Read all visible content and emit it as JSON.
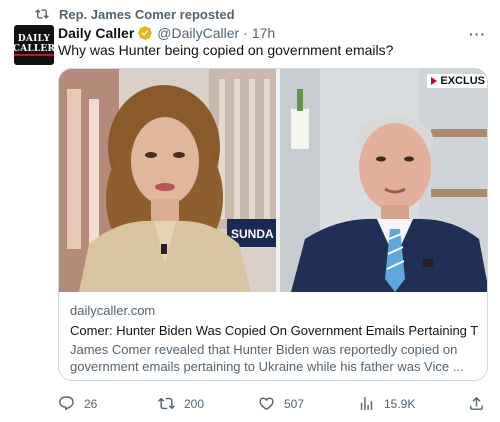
{
  "repost": {
    "text": "Rep. James Comer reposted",
    "icon": "repost-icon"
  },
  "author": {
    "avatar_line1": "DAILY",
    "avatar_line2": "CALLER",
    "name": "Daily Caller",
    "verified_color": "#e2b719",
    "handle": "@DailyCaller",
    "separator": "·",
    "time": "17h"
  },
  "more_label": "···",
  "tweet_text": "Why was Hunter being copied on government emails?",
  "card": {
    "media_badge": "EXCLUS",
    "lower_third_text": "SUNDA",
    "domain": "dailycaller.com",
    "title": "Comer: Hunter Biden Was Copied On Government Emails Pertaining T...",
    "description": "James Comer revealed that Hunter Biden was reportedly copied on government emails pertaining to Ukraine while his father was Vice ..."
  },
  "actions": {
    "replies": "26",
    "reposts": "200",
    "likes": "507",
    "views": "15.9K"
  },
  "colors": {
    "text": "#0f1419",
    "secondary": "#536471",
    "border": "#cfd9de"
  }
}
